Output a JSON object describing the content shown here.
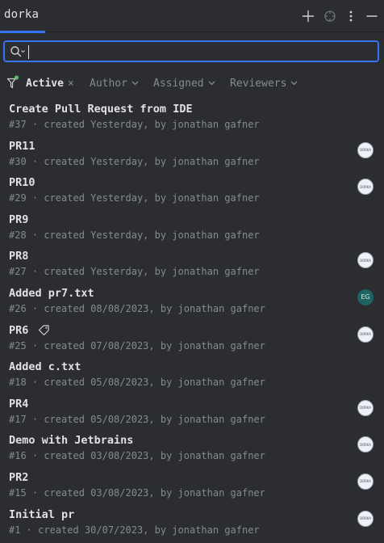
{
  "tab": {
    "label": "dorka"
  },
  "toolbar": {
    "add_icon": "plus-icon",
    "target_icon": "crosshair-icon",
    "more_icon": "vertical-ellipsis-icon",
    "minimize_icon": "minus-icon"
  },
  "search": {
    "value": "",
    "placeholder": ""
  },
  "filters": {
    "active_label": "Active",
    "author_label": "Author",
    "assigned_label": "Assigned",
    "reviewers_label": "Reviewers"
  },
  "colors": {
    "background": "#2b2d30",
    "accent": "#3574f0",
    "filter_dot": "#5fb865",
    "avatar_eg": "#1d6463"
  },
  "pull_requests": [
    {
      "title": "Create Pull Request from IDE",
      "meta": "#37 · created Yesterday, by jonathan gafner",
      "avatar": ""
    },
    {
      "title": "PR11",
      "meta": "#30 · created Yesterday, by jonathan gafner",
      "avatar": "image"
    },
    {
      "title": "PR10",
      "meta": "#29 · created Yesterday, by jonathan gafner",
      "avatar": "image"
    },
    {
      "title": "PR9",
      "meta": "#28 · created Yesterday, by jonathan gafner",
      "avatar": ""
    },
    {
      "title": "PR8",
      "meta": "#27 · created Yesterday, by jonathan gafner",
      "avatar": "image"
    },
    {
      "title": "Added pr7.txt",
      "meta": "#26 · created 08/08/2023, by jonathan gafner",
      "avatar": "EG"
    },
    {
      "title": "PR6",
      "meta": "#25 · created 07/08/2023, by jonathan gafner",
      "avatar": "image",
      "tag_icon": "tag-icon"
    },
    {
      "title": "Added c.txt",
      "meta": "#18 · created 05/08/2023, by jonathan gafner",
      "avatar": ""
    },
    {
      "title": "PR4",
      "meta": "#17 · created 05/08/2023, by jonathan gafner",
      "avatar": "image"
    },
    {
      "title": "Demo with Jetbrains",
      "meta": "#16 · created 03/08/2023, by jonathan gafner",
      "avatar": "image"
    },
    {
      "title": "PR2",
      "meta": "#15 · created 03/08/2023, by jonathan gafner",
      "avatar": "image"
    },
    {
      "title": "Initial pr",
      "meta": "#1 · created 30/07/2023, by jonathan gafner",
      "avatar": "image"
    }
  ]
}
